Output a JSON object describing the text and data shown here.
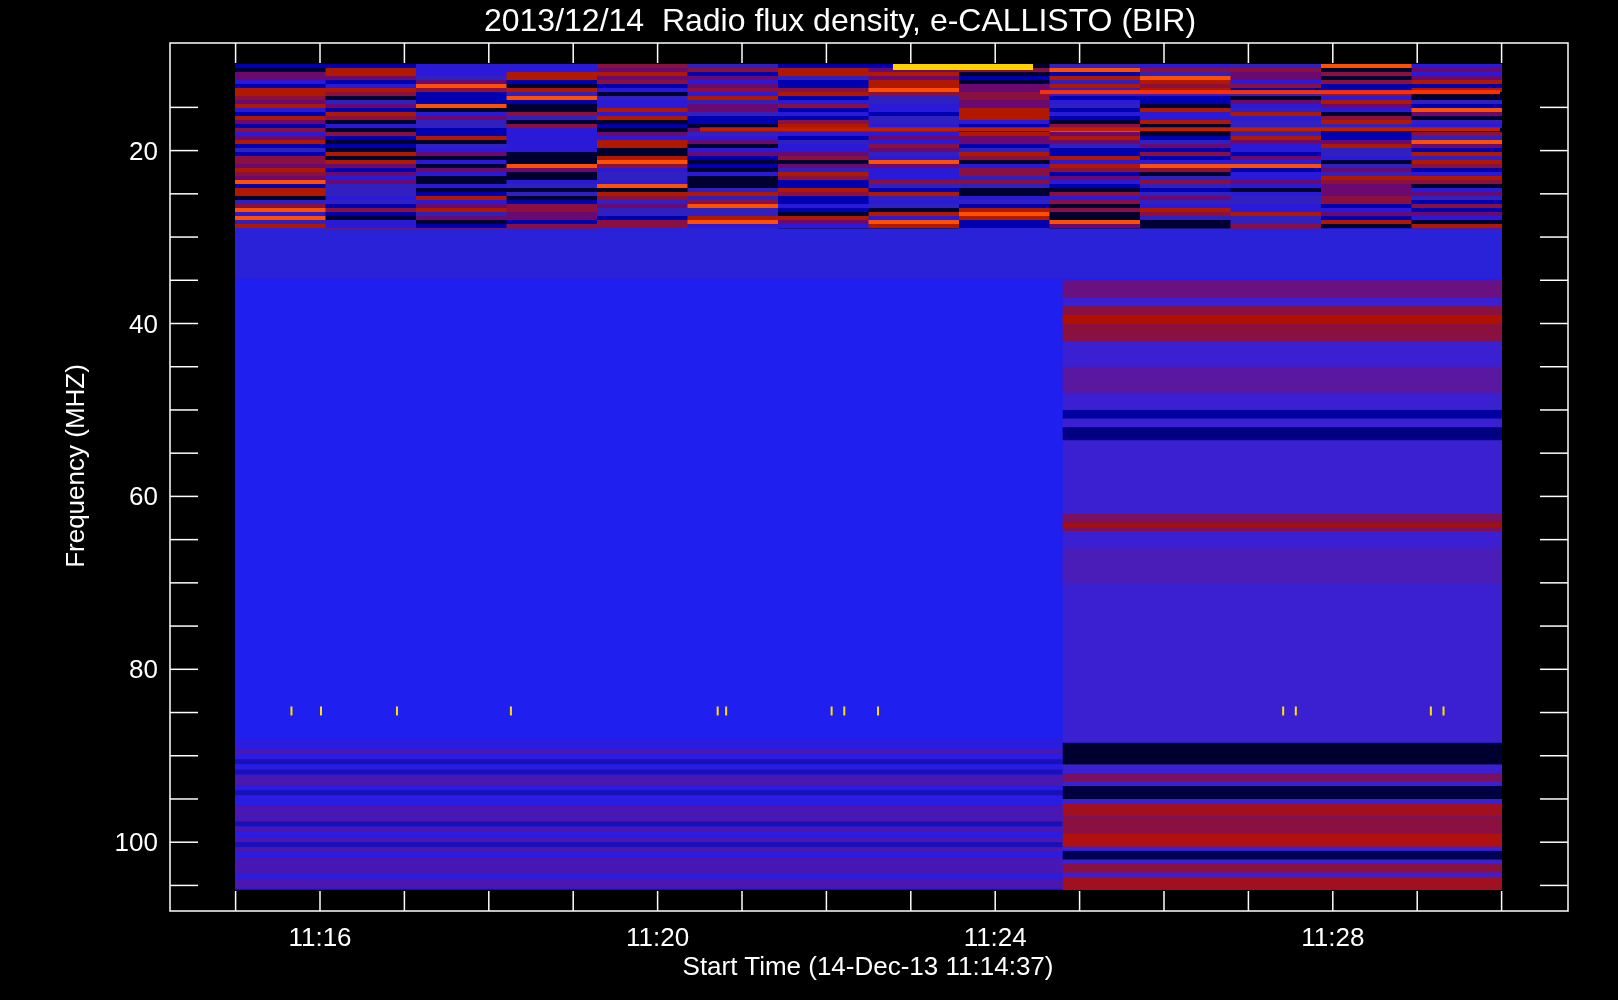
{
  "title": "2013/12/14  Radio flux density, e-CALLISTO (BIR)",
  "y_axis": {
    "label": "Frequency (MHZ)",
    "ticks": [
      "20",
      "40",
      "60",
      "80",
      "100"
    ]
  },
  "x_axis": {
    "label": "Start Time (14-Dec-13 11:14:37)",
    "ticks": [
      "11:16",
      "11:20",
      "11:24",
      "11:28"
    ]
  }
}
